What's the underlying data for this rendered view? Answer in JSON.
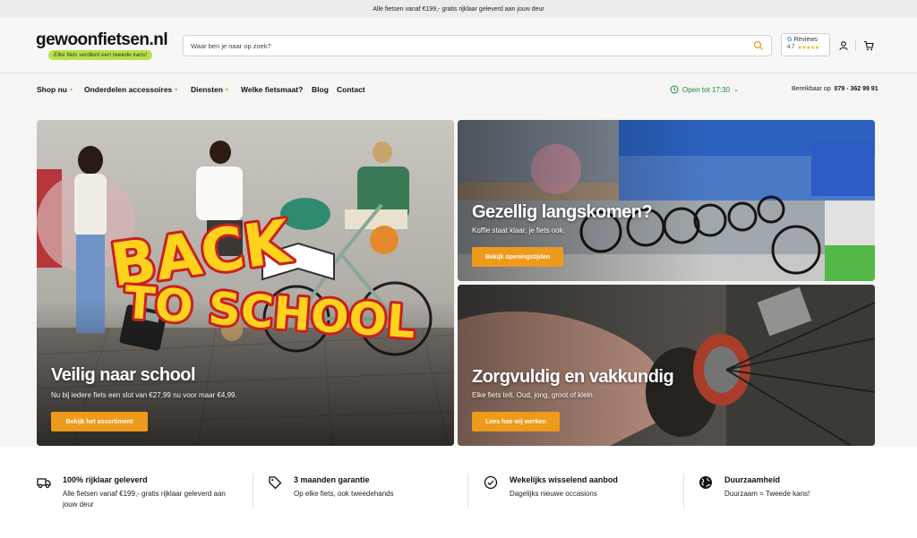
{
  "topbar": {
    "text": "Alle fietsen vanaf €199,- gratis rijklaar geleverd aan jouw deur"
  },
  "header": {
    "logo_text": "gewoonfietsen.nl",
    "logo_tagline": "Elke fiets verdient een tweede kans!",
    "search_placeholder": "Waar ben je naar op zoek?",
    "reviews": {
      "label": "Reviews",
      "rating": "4.7",
      "stars": "★★★★★"
    }
  },
  "nav": {
    "items": [
      {
        "label": "Shop nu",
        "caret": true
      },
      {
        "label": "Onderdelen accessoires",
        "caret": true
      },
      {
        "label": "Diensten",
        "caret": true
      },
      {
        "label": "Welke fietsmaat?",
        "caret": false
      },
      {
        "label": "Blog",
        "caret": false
      },
      {
        "label": "Contact",
        "caret": false
      }
    ],
    "open_hours": "Open tot 17:30",
    "reachable_label": "Bereikbaar op",
    "phone": "079 - 362 99 91"
  },
  "hero": {
    "main": {
      "graphic_text_1": "BACK",
      "graphic_text_2": "TO SCHOOL",
      "title": "Veilig naar school",
      "subtitle": "Nu bij iedere fiets een slot van €27,99 nu voor maar €4,99.",
      "button": "Bekijk het assortiment"
    },
    "top_right": {
      "title": "Gezellig langskomen?",
      "subtitle": "Koffie staat klaar, je fiets ook.",
      "button": "Bekijk openingstijden"
    },
    "bottom_right": {
      "title": "Zorgvuldig en vakkundig",
      "subtitle": "Elke fiets telt. Oud, jong, groot of klein.",
      "button": "Lees hoe wij werken"
    }
  },
  "usps": [
    {
      "icon": "truck-icon",
      "title": "100% rijklaar geleverd",
      "desc": "Alle fietsen vanaf €199,- gratis rijklaar geleverd aan jouw deur"
    },
    {
      "icon": "tag-icon",
      "title": "3 maanden garantie",
      "desc": "Op elke fiets, ook tweedehands"
    },
    {
      "icon": "check-circle-icon",
      "title": "Wekelijks wisselend aanbod",
      "desc": "Dagelijks nieuwe occasions"
    },
    {
      "icon": "globe-icon",
      "title": "Duurzaamheid",
      "desc": "Duurzaam = Tweede kans!"
    }
  ],
  "colors": {
    "accent": "#ee9a1a",
    "open": "#1f8a34",
    "tagline_bg": "#b8e04a"
  }
}
